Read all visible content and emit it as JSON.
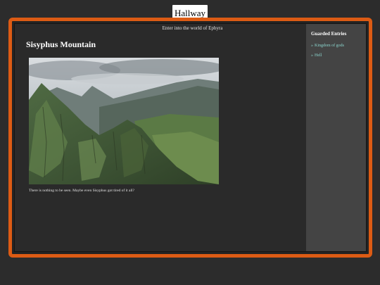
{
  "window": {
    "title": "Hallway"
  },
  "header": {
    "subtitle": "Enter into the world of Ephyra"
  },
  "main": {
    "title": "Sisyphus Mountain",
    "caption": "There is nothing to be seen. Maybe even Sisyphus got tired of it all?"
  },
  "sidebar": {
    "title": "Guarded Entries",
    "items": [
      {
        "bullet": "»",
        "label": "Kingdom of gods"
      },
      {
        "bullet": "»",
        "label": "Hell"
      }
    ]
  },
  "colors": {
    "accent": "#dc5b14",
    "background": "#2c2c2c",
    "panel": "#2a2a2a",
    "sidebar": "#444444",
    "link": "#8bd4cc"
  }
}
